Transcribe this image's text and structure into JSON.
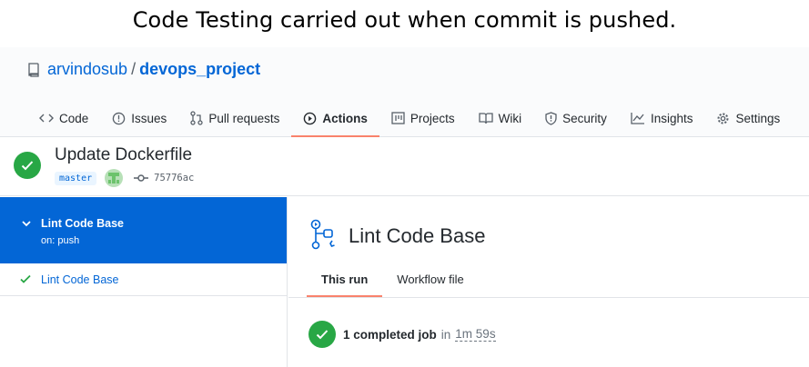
{
  "caption": "Code Testing carried out when commit is pushed.",
  "repo": {
    "owner": "arvindosub",
    "separator": "/",
    "name": "devops_project"
  },
  "nav": {
    "tabs": [
      {
        "label": "Code",
        "icon": "code-icon"
      },
      {
        "label": "Issues",
        "icon": "issue-icon"
      },
      {
        "label": "Pull requests",
        "icon": "pull-request-icon"
      },
      {
        "label": "Actions",
        "icon": "play-icon",
        "active": true
      },
      {
        "label": "Projects",
        "icon": "project-icon"
      },
      {
        "label": "Wiki",
        "icon": "book-icon"
      },
      {
        "label": "Security",
        "icon": "shield-icon"
      },
      {
        "label": "Insights",
        "icon": "graph-icon"
      },
      {
        "label": "Settings",
        "icon": "gear-icon"
      }
    ]
  },
  "run": {
    "title": "Update Dockerfile",
    "branch": "master",
    "commit_sha": "75776ac",
    "status": "success"
  },
  "sidebar": {
    "workflow": {
      "name": "Lint Code Base",
      "trigger": "on: push"
    },
    "jobs": [
      {
        "name": "Lint Code Base",
        "status": "success"
      }
    ]
  },
  "main": {
    "workflow_title": "Lint Code Base",
    "tabs": [
      {
        "label": "This run",
        "active": true
      },
      {
        "label": "Workflow file"
      }
    ],
    "summary": {
      "text": "1 completed job",
      "in": "in",
      "duration": "1m 59s"
    }
  },
  "colors": {
    "accent": "#0366d6",
    "success": "#28a745",
    "tab_underline": "#f9826c"
  }
}
